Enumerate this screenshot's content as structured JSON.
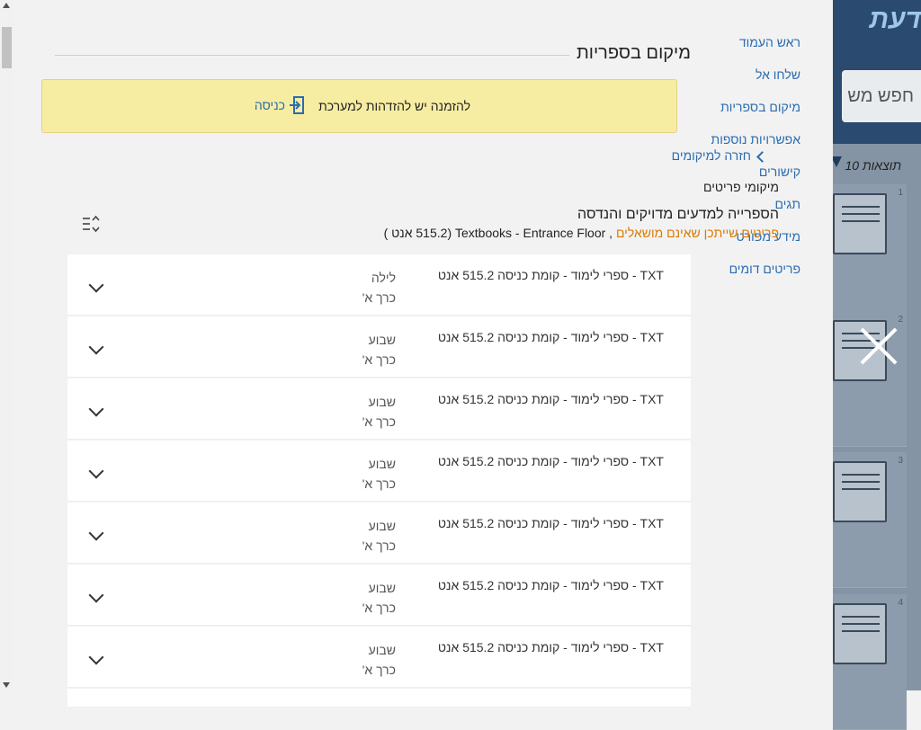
{
  "background_page": {
    "logo_text": "דעת",
    "search_button_label": "חפש מש",
    "results_count": "10 תוצאות",
    "result_numbers": [
      "1",
      "2",
      "3",
      "4"
    ]
  },
  "side_nav": {
    "items": [
      {
        "label": "ראש העמוד"
      },
      {
        "label": "שלחו אל"
      },
      {
        "label": "מיקום בספריות"
      },
      {
        "label": "אפשרויות נוספות"
      },
      {
        "label": "קישורים"
      },
      {
        "label": "תגים"
      },
      {
        "label": "מידע מפורט"
      },
      {
        "label": "פריטים דומים"
      }
    ]
  },
  "main": {
    "section_title": "מיקום בספריות",
    "login_notice": {
      "text": "להזמנה יש להזדהות למערכת",
      "link_label": "כניסה"
    },
    "back_link": "חזרה למיקומים",
    "items_label": "מיקומי פריטים",
    "library_name": "הספרייה למדעים מדויקים והנדסה",
    "availability": "פריטים שייתכן שאינם מושאלים",
    "shelf_location": ", Textbooks - Entrance Floor (515.2 אנט )",
    "items": [
      {
        "location": "TXT - ספרי לימוד - קומת כניסה 515.2 אנט",
        "policy": "לילה",
        "volume": "כרך א'"
      },
      {
        "location": "TXT - ספרי לימוד - קומת כניסה 515.2 אנט",
        "policy": "שבוע",
        "volume": "כרך א'"
      },
      {
        "location": "TXT - ספרי לימוד - קומת כניסה 515.2 אנט",
        "policy": "שבוע",
        "volume": "כרך א'"
      },
      {
        "location": "TXT - ספרי לימוד - קומת כניסה 515.2 אנט",
        "policy": "שבוע",
        "volume": "כרך א'"
      },
      {
        "location": "TXT - ספרי לימוד - קומת כניסה 515.2 אנט",
        "policy": "שבוע",
        "volume": "כרך א'"
      },
      {
        "location": "TXT - ספרי לימוד - קומת כניסה 515.2 אנט",
        "policy": "שבוע",
        "volume": "כרך א'"
      },
      {
        "location": "TXT - ספרי לימוד - קומת כניסה 515.2 אנט",
        "policy": "שבוע",
        "volume": "כרך א'"
      }
    ]
  },
  "colors": {
    "link": "#2a6cb0",
    "notice_bg": "#f7eda2",
    "availability": "#d97a00",
    "header_bg": "#2b4a6f"
  }
}
